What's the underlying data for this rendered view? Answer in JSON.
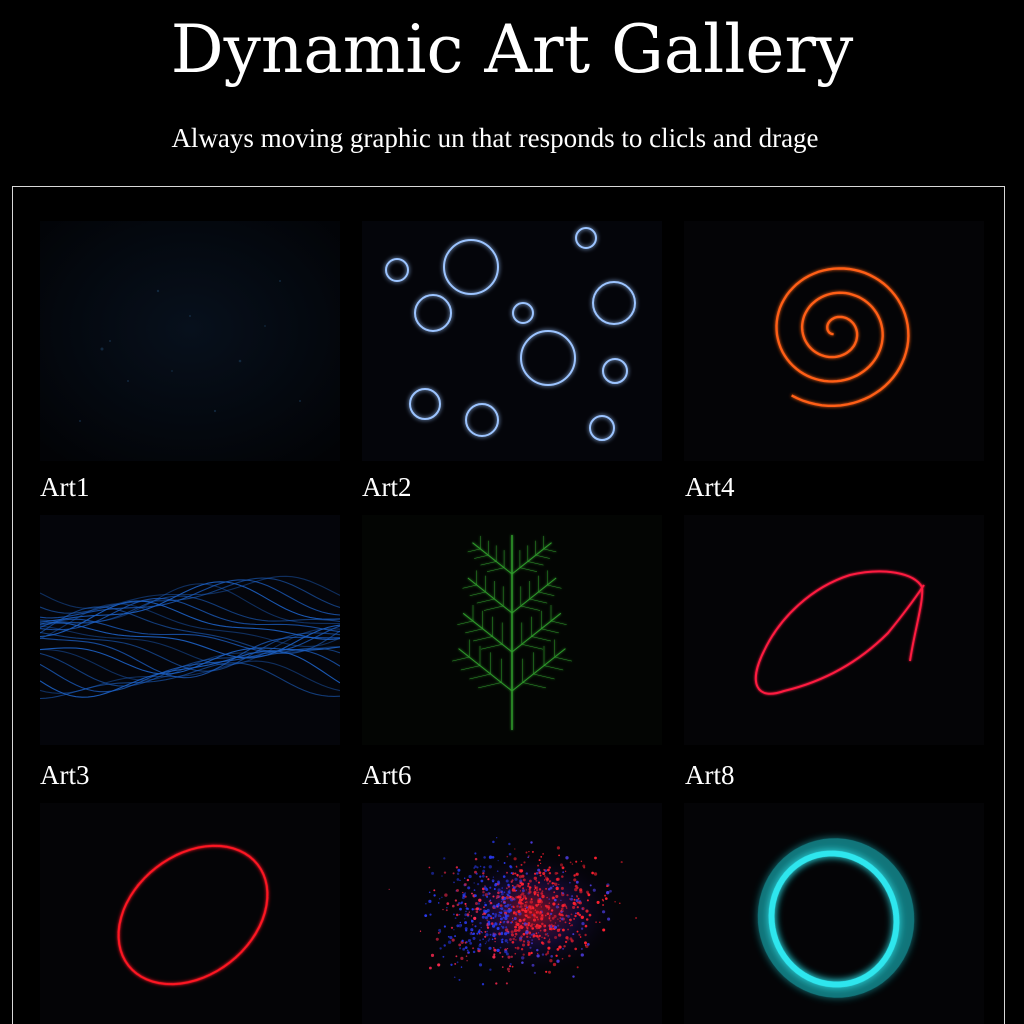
{
  "page": {
    "title": "Dynamic Art Gallery",
    "subtitle": "Always moving graphic un that responds to clicls and drage"
  },
  "gallery": {
    "tiles": [
      {
        "label": "Art1",
        "art": "dim-particle-field",
        "color": "#0a1a2e"
      },
      {
        "label": "Art2",
        "art": "glowing-bubbles",
        "color": "#5aa0ff"
      },
      {
        "label": "Art4",
        "art": "orange-spiral",
        "color": "#ff5a14"
      },
      {
        "label": "Art3",
        "art": "flowing-wave-lines",
        "color": "#1e6ad6"
      },
      {
        "label": "Art6",
        "art": "green-fractal-fern",
        "color": "#2ea82a"
      },
      {
        "label": "Art8",
        "art": "red-looping-line",
        "color": "#ff1a3c"
      },
      {
        "label": "",
        "art": "red-ellipse-ring",
        "color": "#ff1020"
      },
      {
        "label": "",
        "art": "red-blue-particle-cloud",
        "color": "#ff2030"
      },
      {
        "label": "",
        "art": "cyan-glow-ring",
        "color": "#22d6e0"
      }
    ]
  }
}
